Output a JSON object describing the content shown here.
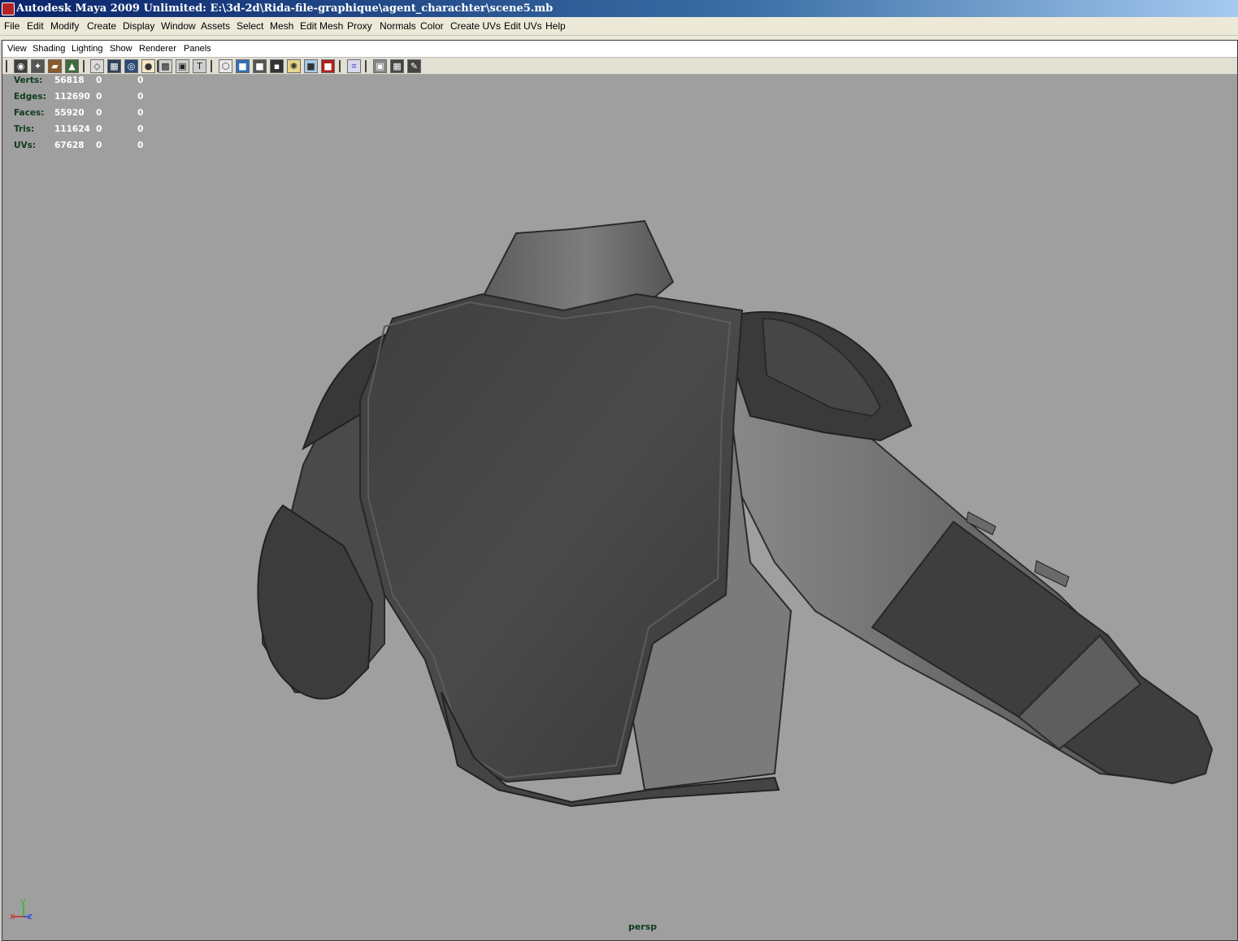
{
  "window": {
    "title": "Autodesk Maya 2009 Unlimited: E:\\3d-2d\\Rida-file-graphique\\agent_charachter\\scene5.mb"
  },
  "main_menu": [
    "File",
    "Edit",
    "Modify",
    "Create",
    "Display",
    "Window",
    "Assets",
    "Select",
    "Mesh",
    "Edit Mesh",
    "Proxy",
    "Normals",
    "Color",
    "Create UVs",
    "Edit UVs",
    "Help"
  ],
  "panel_menu": [
    "View",
    "Shading",
    "Lighting",
    "Show",
    "Renderer",
    "Panels"
  ],
  "toolbar_icons": [
    "select-camera-icon",
    "camera-attributes-icon",
    "bookmark-icon",
    "image-plane-icon",
    "grid-icon",
    "film-gate-icon",
    "resolution-gate-icon",
    "gate-mask-icon",
    "field-chart-icon",
    "safe-action-icon",
    "safe-title-icon",
    "wireframe-icon",
    "smooth-shade-icon",
    "flat-shade-icon",
    "bounding-box-icon",
    "lights-icon",
    "xray-icon",
    "textured-icon",
    "isolate-select-icon",
    "frame-all-icon",
    "frame-selection-icon",
    "xray-joints-icon",
    "shadows-icon"
  ],
  "poly_count": {
    "rows": [
      {
        "label": "Verts:",
        "total": "56818",
        "sel": "0",
        "comp": "0"
      },
      {
        "label": "Edges:",
        "total": "112690",
        "sel": "0",
        "comp": "0"
      },
      {
        "label": "Faces:",
        "total": "55920",
        "sel": "0",
        "comp": "0"
      },
      {
        "label": "Tris:",
        "total": "111624",
        "sel": "0",
        "comp": "0"
      },
      {
        "label": "UVs:",
        "total": "67628",
        "sel": "0",
        "comp": "0"
      }
    ]
  },
  "viewport": {
    "camera": "persp",
    "background": "#9f9f9f"
  },
  "axis": {
    "x": "x",
    "y": "y",
    "z": "z"
  },
  "colors": {
    "title_start": "#0a246a",
    "title_end": "#a6caf0",
    "hud_label": "#0e3b1e",
    "model_dark": "#3c3c3c",
    "model_light": "#7a7a7a"
  }
}
